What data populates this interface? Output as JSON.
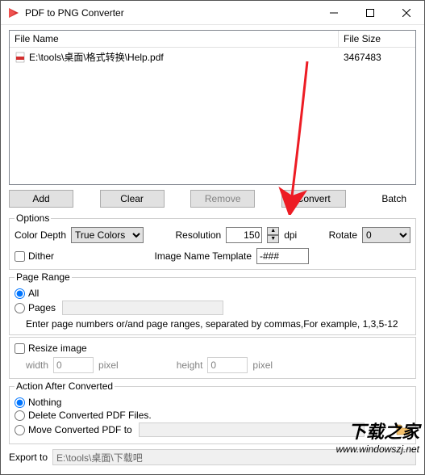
{
  "window": {
    "title": "PDF to PNG Converter"
  },
  "fileList": {
    "columns": {
      "name": "File Name",
      "size": "File Size"
    },
    "rows": [
      {
        "name": "E:\\tools\\桌面\\格式转换\\Help.pdf",
        "size": "3467483"
      }
    ]
  },
  "buttons": {
    "add": "Add",
    "clear": "Clear",
    "remove": "Remove",
    "convert": "Convert",
    "batch": "Batch"
  },
  "options": {
    "legend": "Options",
    "colorDepthLabel": "Color Depth",
    "colorDepthValue": "True Colors",
    "resolutionLabel": "Resolution",
    "resolutionValue": "150",
    "resolutionUnit": "dpi",
    "rotateLabel": "Rotate",
    "rotateValue": "0",
    "ditherLabel": "Dither",
    "templateLabel": "Image Name Template",
    "templateValue": "-###"
  },
  "pageRange": {
    "legend": "Page Range",
    "all": "All",
    "pages": "Pages",
    "hint": "Enter page numbers or/and page ranges, separated by commas,For example, 1,3,5-12"
  },
  "resize": {
    "label": "Resize image",
    "widthLabel": "width",
    "widthValue": "0",
    "heightLabel": "height",
    "heightValue": "0",
    "unit": "pixel"
  },
  "action": {
    "legend": "Action After Converted",
    "nothing": "Nothing",
    "delete": "Delete Converted PDF Files.",
    "move": "Move Converted PDF to"
  },
  "export": {
    "label": "Export to",
    "path": "E:\\tools\\桌面\\下载吧"
  },
  "watermark": {
    "cn": "下载之家",
    "url": "www.windowszj.net"
  }
}
